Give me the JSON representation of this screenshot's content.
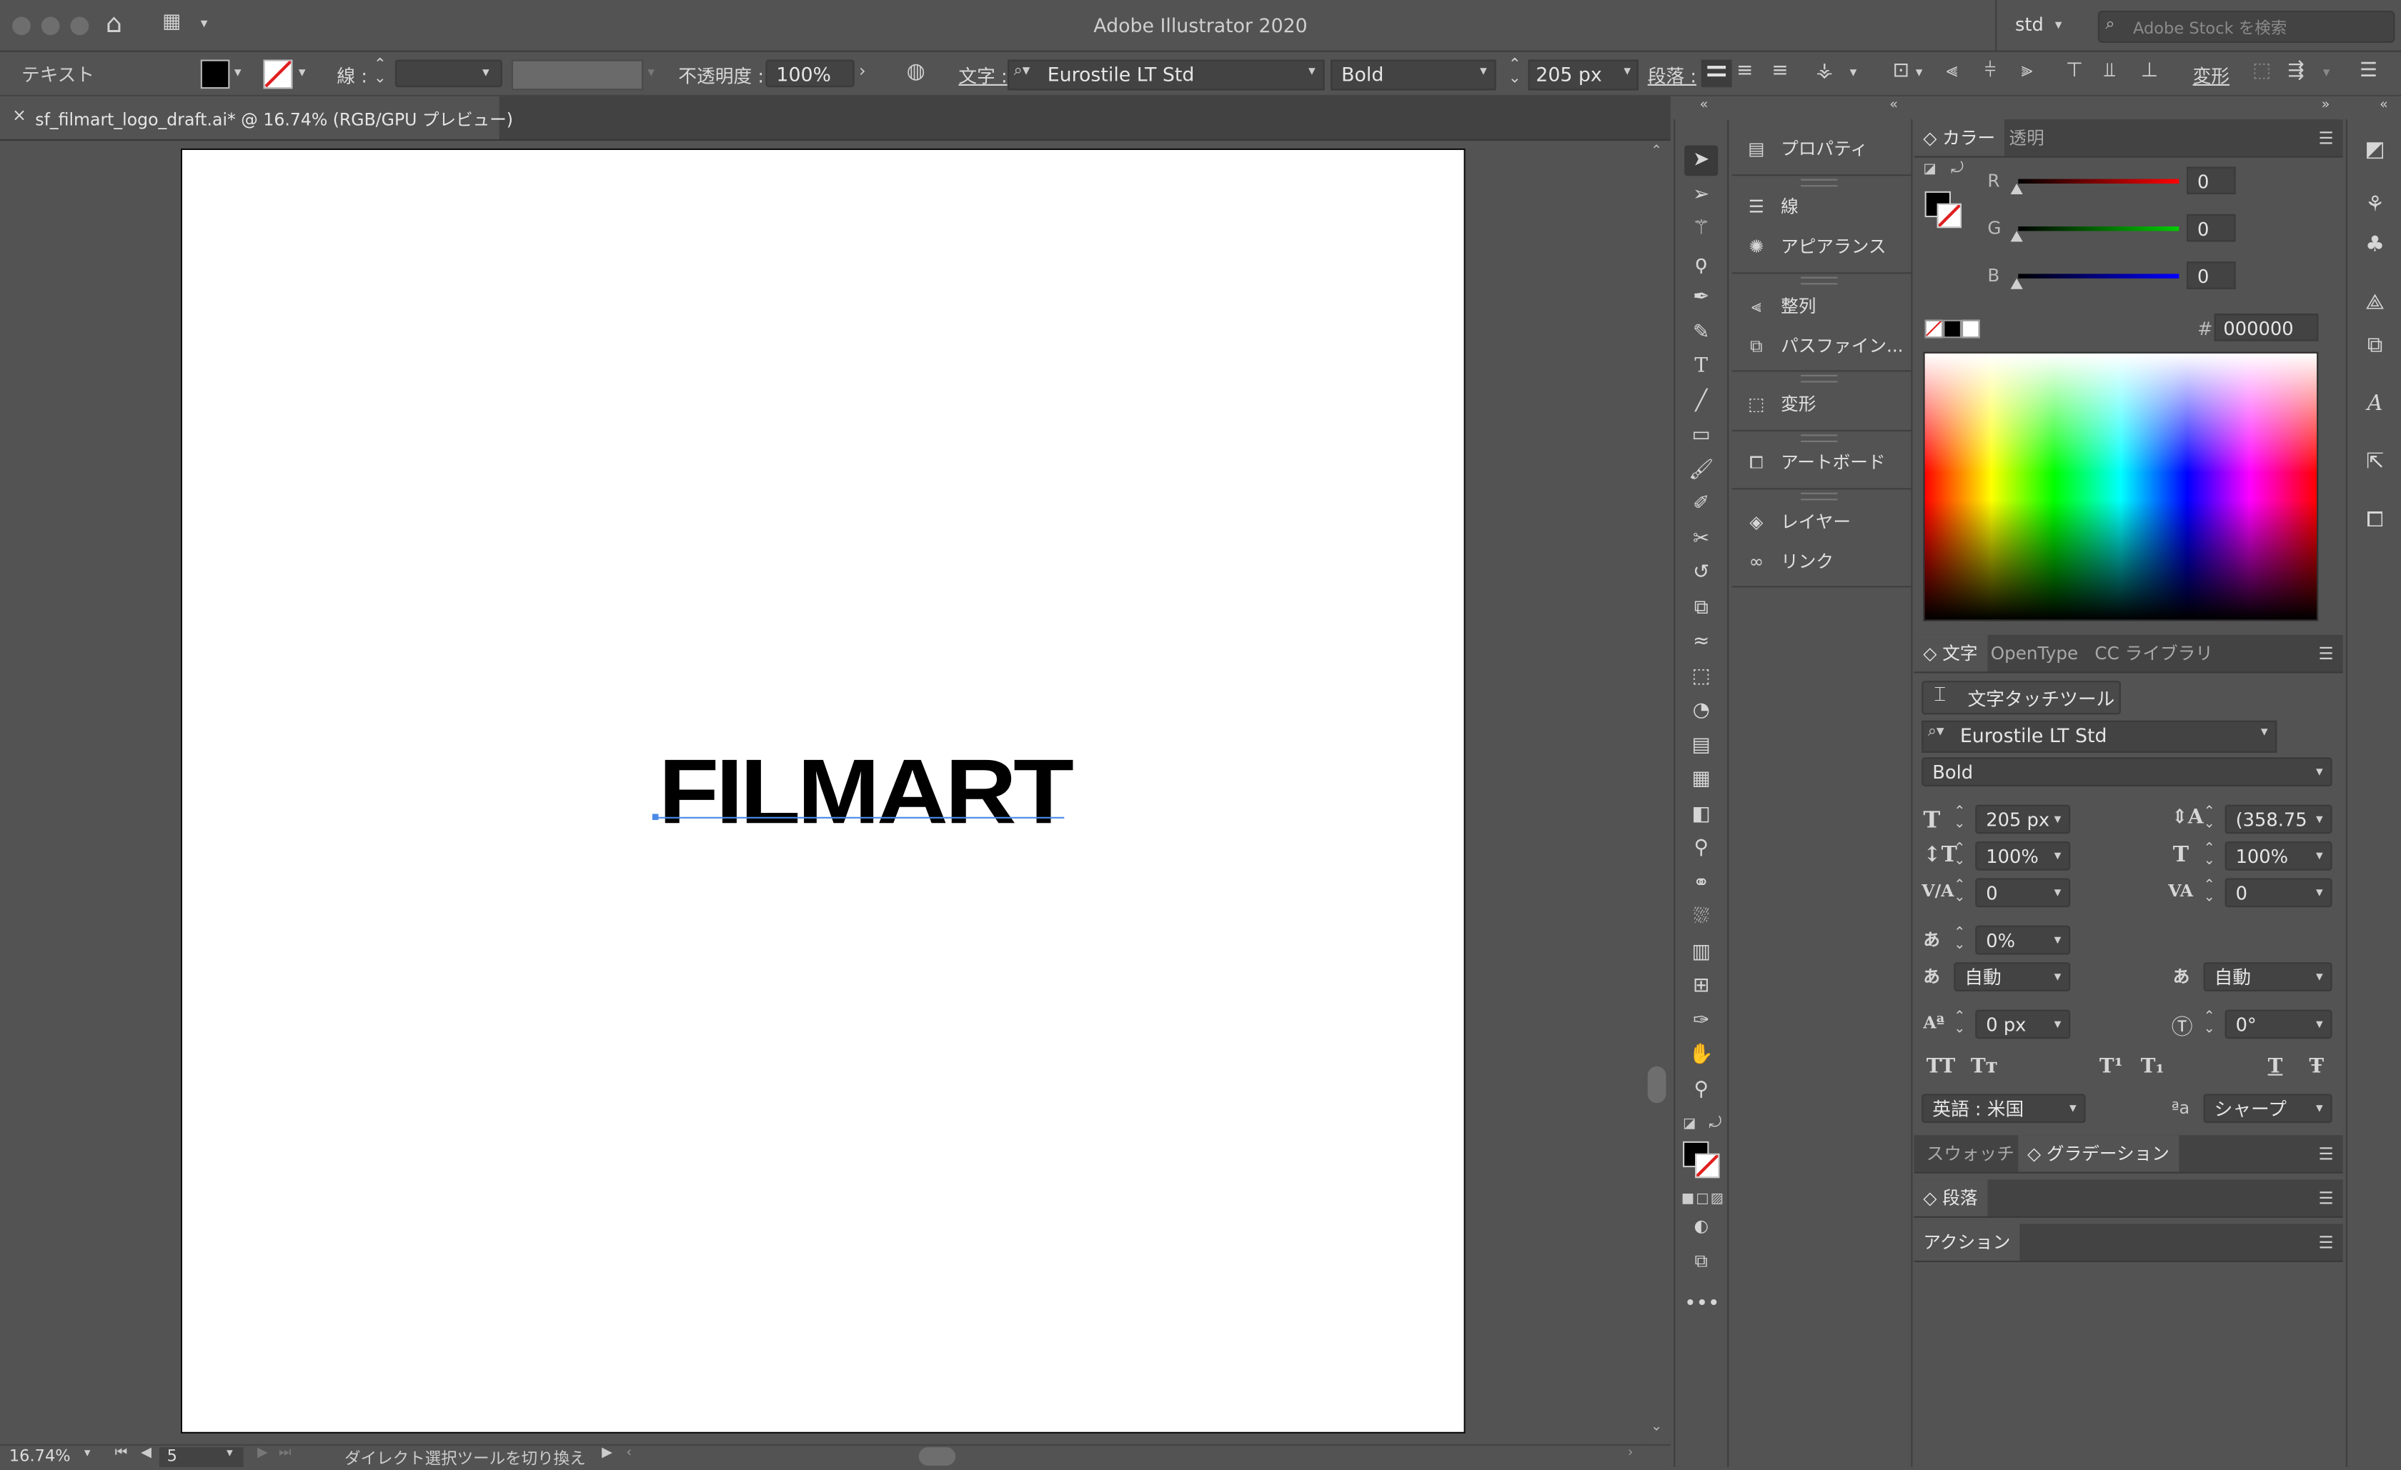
{
  "window": {
    "title": "Adobe Illustrator 2020",
    "workspace": "std",
    "search_placeholder": "Adobe Stock を検索"
  },
  "control_bar": {
    "mode": "テキスト",
    "stroke_label": "線 :",
    "opacity_label": "不透明度 :",
    "opacity_value": "100%",
    "char_label": "文字 :",
    "font_family": "Eurostile LT Std",
    "font_style": "Bold",
    "font_size": "205 px",
    "para_label": "段落 :",
    "transform_label": "変形"
  },
  "document": {
    "tab_title": "sf_filmart_logo_draft.ai* @ 16.74% (RGB/GPU プレビュー)",
    "close_glyph": "×",
    "artwork_text": "FILMART"
  },
  "status_bar": {
    "zoom": "16.74%",
    "artboard_number": "5",
    "tool_hint": "ダイレクト選択ツールを切り換え"
  },
  "collapsed_panels": [
    {
      "label": "プロパティ",
      "icon": "properties-icon"
    },
    {
      "label": "線",
      "icon": "stroke-icon"
    },
    {
      "label": "アピアランス",
      "icon": "appearance-icon"
    },
    {
      "label": "整列",
      "icon": "align-icon"
    },
    {
      "label": "パスファイン...",
      "icon": "pathfinder-icon"
    },
    {
      "label": "変形",
      "icon": "transform-icon"
    },
    {
      "label": "アートボード",
      "icon": "artboard-icon"
    },
    {
      "label": "レイヤー",
      "icon": "layers-icon"
    },
    {
      "label": "リンク",
      "icon": "links-icon"
    }
  ],
  "color_panel": {
    "tabs": [
      "カラー",
      "透明"
    ],
    "r_label": "R",
    "r_value": "0",
    "g_label": "G",
    "g_value": "0",
    "b_label": "B",
    "b_value": "0",
    "hex_label": "#",
    "hex_value": "000000",
    "colors": {
      "r": "#ff0000",
      "g": "#00cc00",
      "b": "#0000ff"
    }
  },
  "character_panel": {
    "tabs": [
      "文字",
      "OpenType",
      "CC ライブラリ"
    ],
    "touch_tool": "文字タッチツール",
    "font_family": "Eurostile LT Std",
    "font_style": "Bold",
    "size": "205 px",
    "leading": "(358.75",
    "vscale": "100%",
    "hscale": "100%",
    "kerning": "0",
    "tracking": "0",
    "tsume": "0%",
    "aki_left": "自動",
    "aki_right": "自動",
    "baseline_shift": "0 px",
    "rotation": "0°",
    "style_buttons": [
      "TT",
      "Tт",
      "T¹",
      "T₁",
      "T",
      "Ŧ"
    ],
    "language": "英語 : 米国",
    "aa_label": "ªa",
    "antialias": "シャープ"
  },
  "bottom_panels": {
    "swatches": "スウォッチ",
    "gradient": "グラデーション",
    "paragraph": "段落",
    "actions": "アクション"
  }
}
